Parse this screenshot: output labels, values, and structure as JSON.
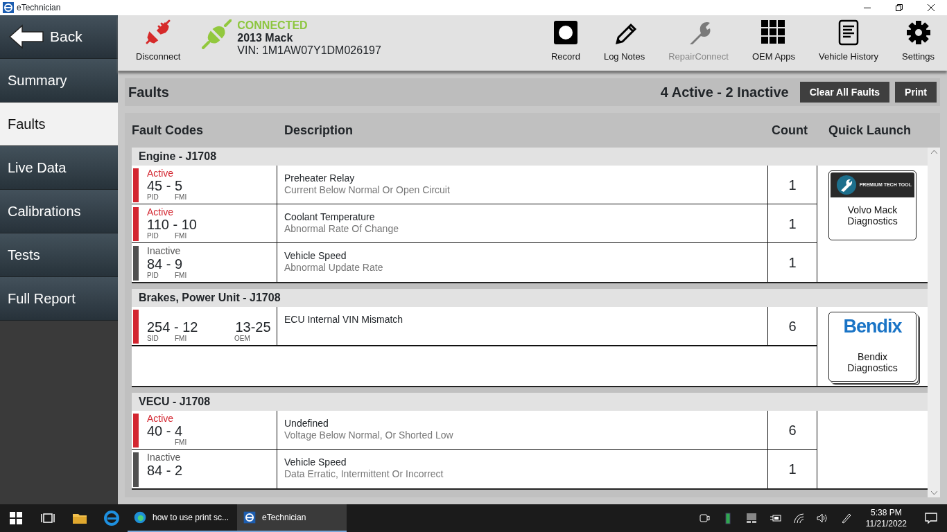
{
  "window": {
    "title": "eTechnician"
  },
  "sidebar": {
    "back": "Back",
    "items": [
      {
        "label": "Summary",
        "selected": false
      },
      {
        "label": "Faults",
        "selected": true
      },
      {
        "label": "Live Data",
        "selected": false
      },
      {
        "label": "Calibrations",
        "selected": false
      },
      {
        "label": "Tests",
        "selected": false
      },
      {
        "label": "Full Report",
        "selected": false
      }
    ]
  },
  "toolbar": {
    "disconnect": "Disconnect",
    "connection": {
      "status": "CONNECTED",
      "vehicle": "2013 Mack",
      "vin": "VIN: 1M1AW07Y1DM026197"
    },
    "tools": [
      {
        "kind": "record",
        "label": "Record",
        "disabled": false
      },
      {
        "kind": "notes",
        "label": "Log Notes",
        "disabled": false
      },
      {
        "kind": "wrench",
        "label": "RepairConnect",
        "disabled": true
      },
      {
        "kind": "apps",
        "label": "OEM Apps",
        "disabled": false
      },
      {
        "kind": "history",
        "label": "Vehicle History",
        "disabled": false
      },
      {
        "kind": "settings",
        "label": "Settings",
        "disabled": false
      }
    ]
  },
  "faults_bar": {
    "title": "Faults",
    "summary": "4 Active - 2 Inactive",
    "buttons": [
      "Clear All Faults",
      "Print"
    ]
  },
  "table": {
    "columns": [
      "Fault Codes",
      "Description",
      "Count",
      "Quick Launch"
    ],
    "groups": [
      {
        "name": "Engine - J1708",
        "quick_launch": {
          "kind": "premium",
          "logo_text": "PREMIUM TECH TOOL",
          "label": "Volvo Mack Diagnostics"
        },
        "rows": [
          {
            "active": true,
            "status": "Active",
            "code": "45 - 5",
            "label_1": "PID",
            "label_2": "FMI",
            "title": "Preheater Relay",
            "detail": "Current Below Normal Or Open Circuit",
            "count": "1"
          },
          {
            "active": true,
            "status": "Active",
            "code": "110 - 10",
            "label_1": "PID",
            "label_2": "FMI",
            "title": "Coolant Temperature",
            "detail": "Abnormal Rate Of Change",
            "count": "1"
          },
          {
            "active": false,
            "status": "Inactive",
            "code": "84 - 9",
            "label_1": "PID",
            "label_2": "FMI",
            "title": "Vehicle Speed",
            "detail": "Abnormal Update Rate",
            "count": "1"
          }
        ]
      },
      {
        "name": "Brakes, Power Unit - J1708",
        "quick_launch": {
          "kind": "bendix",
          "logo_text": "Bendix",
          "label": "Bendix Diagnostics"
        },
        "rows": [
          {
            "active": true,
            "code": "254 - 12",
            "label_1": "SID",
            "label_2": "FMI",
            "oem_code": "13-25",
            "oem_label": "OEM",
            "title": "ECU Internal VIN Mismatch",
            "count": "6"
          }
        ]
      },
      {
        "name": "VECU - J1708",
        "rows": [
          {
            "active": true,
            "status": "Active",
            "code": "40 - 4",
            "label_2": "FMI",
            "title": "Undefined",
            "detail": "Voltage Below Normal, Or Shorted Low",
            "count": "6"
          },
          {
            "active": false,
            "status": "Inactive",
            "code": "84 - 2",
            "title": "Vehicle Speed",
            "detail": "Data Erratic, Intermittent Or Incorrect",
            "count": "1"
          }
        ]
      }
    ]
  },
  "taskbar": {
    "apps": [
      {
        "kind": "edge",
        "label": "how to use print sc...",
        "selected": false
      },
      {
        "kind": "etech",
        "label": "eTechnician",
        "selected": true
      }
    ],
    "time": "5:38 PM",
    "date": "11/21/2022"
  }
}
